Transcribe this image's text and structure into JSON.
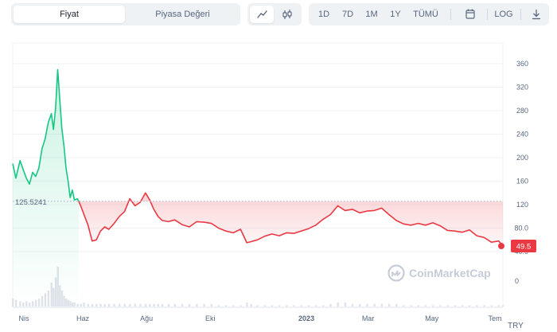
{
  "toolbar": {
    "metric_tabs": [
      {
        "label": "Fiyat",
        "active": true
      },
      {
        "label": "Piyasa Değeri",
        "active": false
      }
    ],
    "chart_type_buttons": [
      {
        "icon": "line-chart-icon",
        "active": true
      },
      {
        "icon": "candlestick-icon",
        "active": false
      }
    ],
    "ranges": [
      "1D",
      "7D",
      "1M",
      "1Y",
      "TÜMÜ"
    ],
    "calendar_icon": "calendar-icon",
    "log_label": "LOG",
    "download_icon": "download-icon"
  },
  "colors": {
    "up": "#16c784",
    "down": "#ea3943",
    "reference_line": "#a6b0c3",
    "grid": "#eff2f5"
  },
  "watermark": "CoinMarketCap",
  "currency": "TRY",
  "chart_data": {
    "type": "line",
    "y_ticks": [
      "360",
      "320",
      "280",
      "240",
      "200",
      "160",
      "120",
      "80.0",
      "40.0"
    ],
    "ylim": [
      40,
      360
    ],
    "x_ticks": [
      "Nis",
      "Haz",
      "Ağu",
      "Eki",
      "2023",
      "Mar",
      "May",
      "Tem"
    ],
    "reference_price": 125.5241,
    "reference_label": "125.5241",
    "current_price": 49.5,
    "current_label": "49.5",
    "volume_axis_label": "0",
    "series": [
      {
        "x": [
          "2022-03-26",
          "2022-03-29",
          "2022-04-02",
          "2022-04-05",
          "2022-04-08",
          "2022-04-11",
          "2022-04-14",
          "2022-04-17",
          "2022-04-20",
          "2022-04-23",
          "2022-04-26",
          "2022-04-29",
          "2022-05-02",
          "2022-05-04",
          "2022-05-06",
          "2022-05-08",
          "2022-05-10",
          "2022-05-12",
          "2022-05-14",
          "2022-05-16",
          "2022-05-18",
          "2022-05-20",
          "2022-05-22",
          "2022-05-24",
          "2022-05-27",
          "2022-05-30",
          "2022-06-02",
          "2022-06-06",
          "2022-06-10",
          "2022-06-14",
          "2022-06-18",
          "2022-06-22",
          "2022-06-26",
          "2022-07-01",
          "2022-07-06",
          "2022-07-11",
          "2022-07-16",
          "2022-07-21",
          "2022-07-26",
          "2022-07-31",
          "2022-08-04",
          "2022-08-08",
          "2022-08-12",
          "2022-08-16",
          "2022-08-22",
          "2022-08-28",
          "2022-09-04",
          "2022-09-11",
          "2022-09-18",
          "2022-09-25",
          "2022-10-02",
          "2022-10-09",
          "2022-10-16",
          "2022-10-23",
          "2022-10-30",
          "2022-11-05",
          "2022-11-09",
          "2022-11-15",
          "2022-11-22",
          "2022-11-29",
          "2022-12-06",
          "2022-12-13",
          "2022-12-20",
          "2022-12-27",
          "2023-01-03",
          "2023-01-10",
          "2023-01-17",
          "2023-01-24",
          "2023-01-31",
          "2023-02-07",
          "2023-02-14",
          "2023-02-21",
          "2023-02-28",
          "2023-03-07",
          "2023-03-14",
          "2023-03-21",
          "2023-03-28",
          "2023-04-04",
          "2023-04-11",
          "2023-04-18",
          "2023-04-25",
          "2023-05-02",
          "2023-05-09",
          "2023-05-16",
          "2023-05-23",
          "2023-05-30",
          "2023-06-06",
          "2023-06-13",
          "2023-06-20",
          "2023-06-27",
          "2023-07-04",
          "2023-07-08"
        ],
        "y": [
          190,
          165,
          195,
          180,
          165,
          155,
          175,
          168,
          182,
          215,
          232,
          260,
          275,
          248,
          285,
          350,
          300,
          250,
          220,
          182,
          160,
          132,
          145,
          128,
          130,
          118,
          104,
          85,
          58,
          60,
          75,
          82,
          78,
          88,
          100,
          108,
          130,
          118,
          124,
          140,
          128,
          112,
          100,
          93,
          91,
          94,
          86,
          82,
          91,
          90,
          88,
          80,
          75,
          72,
          78,
          55,
          57,
          60,
          66,
          70,
          67,
          72,
          71,
          75,
          79,
          85,
          95,
          103,
          118,
          110,
          112,
          106,
          109,
          110,
          114,
          103,
          93,
          87,
          85,
          88,
          85,
          89,
          84,
          76,
          75,
          73,
          77,
          67,
          64,
          56,
          58,
          49.5
        ]
      }
    ],
    "volume": [
      6,
      5,
      4,
      3,
      4,
      3,
      4,
      5,
      6,
      8,
      10,
      12,
      18,
      14,
      22,
      30,
      16,
      12,
      8,
      6,
      5,
      4,
      3,
      3,
      2,
      2,
      3,
      2,
      2,
      2,
      2,
      2,
      2,
      2,
      2,
      2,
      2,
      2,
      2,
      2,
      2,
      2,
      2,
      2,
      2,
      2,
      2,
      2,
      2,
      2,
      2,
      1,
      1,
      1,
      1,
      3,
      2,
      1,
      1,
      1,
      1,
      1,
      1,
      1,
      1,
      1,
      1,
      2,
      3,
      3,
      2,
      2,
      2,
      2,
      2,
      2,
      2,
      1,
      1,
      1,
      1,
      1,
      1,
      1,
      1,
      1,
      1,
      1,
      1,
      1,
      1,
      1
    ]
  }
}
